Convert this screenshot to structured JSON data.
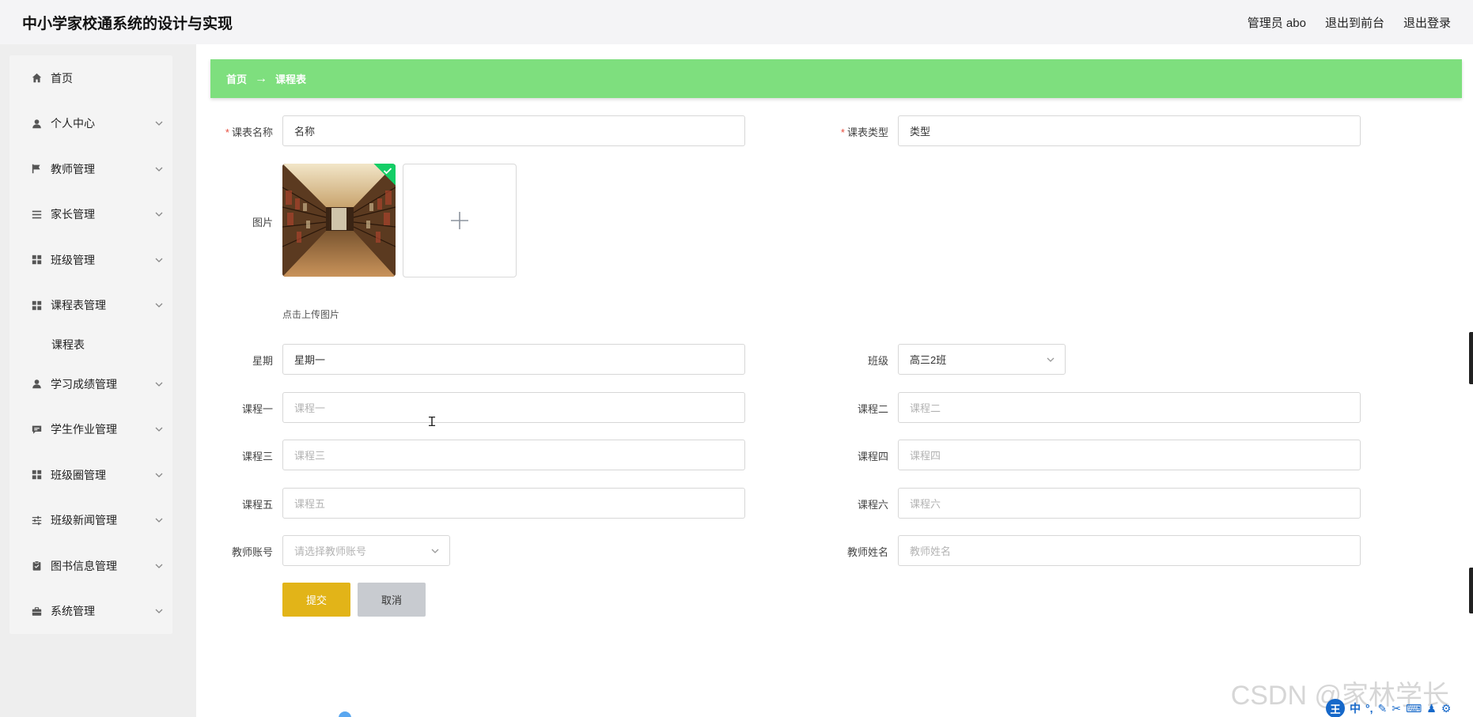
{
  "header": {
    "title": "中小学家校通系统的设计与实现",
    "user": "管理员 abo",
    "to_front": "退出到前台",
    "logout": "退出登录"
  },
  "sidebar": {
    "items": [
      {
        "label": "首页",
        "icon": "home-icon"
      },
      {
        "label": "个人中心",
        "icon": "user-icon"
      },
      {
        "label": "教师管理",
        "icon": "flag-icon"
      },
      {
        "label": "家长管理",
        "icon": "list-icon"
      },
      {
        "label": "班级管理",
        "icon": "grid-icon"
      },
      {
        "label": "课程表管理",
        "icon": "grid-icon"
      },
      {
        "label": "学习成绩管理",
        "icon": "user-icon"
      },
      {
        "label": "学生作业管理",
        "icon": "chat-icon"
      },
      {
        "label": "班级圈管理",
        "icon": "grid-icon"
      },
      {
        "label": "班级新闻管理",
        "icon": "sliders-icon"
      },
      {
        "label": "图书信息管理",
        "icon": "clipboard-icon"
      },
      {
        "label": "系统管理",
        "icon": "briefcase-icon"
      }
    ],
    "submenu": {
      "label": "课程表"
    }
  },
  "breadcrumb": {
    "home": "首页",
    "arrow": "→",
    "current": "课程表"
  },
  "form": {
    "name": {
      "label": "课表名称",
      "value": "名称",
      "required": true
    },
    "type": {
      "label": "课表类型",
      "value": "类型",
      "required": true
    },
    "image": {
      "label": "图片",
      "tip": "点击上传图片"
    },
    "weekday": {
      "label": "星期",
      "value": "星期一"
    },
    "class": {
      "label": "班级",
      "value": "高三2班"
    },
    "course1": {
      "label": "课程一",
      "placeholder": "课程一"
    },
    "course2": {
      "label": "课程二",
      "placeholder": "课程二"
    },
    "course3": {
      "label": "课程三",
      "placeholder": "课程三"
    },
    "course4": {
      "label": "课程四",
      "placeholder": "课程四"
    },
    "course5": {
      "label": "课程五",
      "placeholder": "课程五"
    },
    "course6": {
      "label": "课程六",
      "placeholder": "课程六"
    },
    "teacher_account": {
      "label": "教师账号",
      "placeholder": "请选择教师账号"
    },
    "teacher_name": {
      "label": "教师姓名",
      "placeholder": "教师姓名"
    },
    "submit": "提交",
    "cancel": "取消"
  },
  "watermark": "CSDN @家林学长",
  "ime": {
    "logo": "王",
    "mode": "中"
  },
  "colors": {
    "breadcrumb_bg": "#7edf7e",
    "submit_bg": "#e2b418",
    "cancel_bg": "#c8cbd0",
    "required": "#e74c3c",
    "check_badge": "#13ce66"
  }
}
